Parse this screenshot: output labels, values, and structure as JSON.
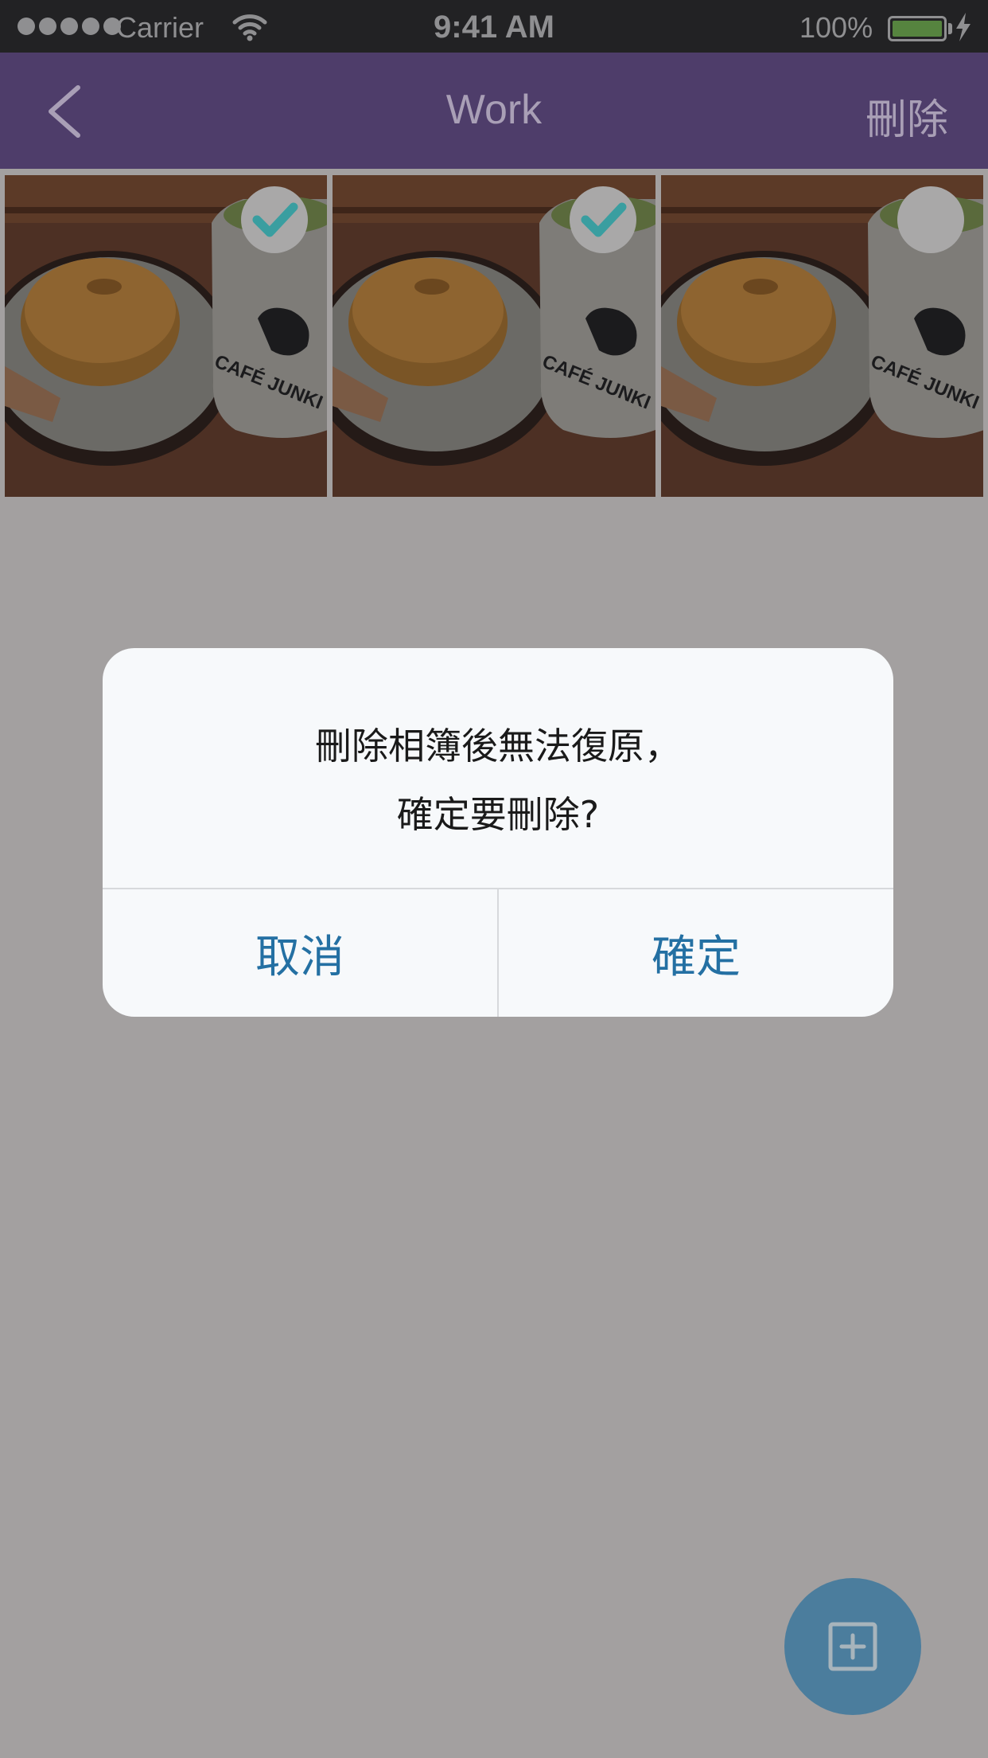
{
  "status_bar": {
    "carrier": "Carrier",
    "time": "9:41 AM",
    "battery": "100%",
    "signal_icon": "signal-dots-icon",
    "wifi_icon": "wifi-icon",
    "battery_icon": "battery-icon",
    "charging_icon": "bolt-icon"
  },
  "nav": {
    "back_icon": "chevron-left-icon",
    "title": "Work",
    "delete_label": "刪除"
  },
  "photos": [
    {
      "cup_text": "CAFÉ JUNKI",
      "selected": true
    },
    {
      "cup_text": "CAFÉ JUNKI",
      "selected": true
    },
    {
      "cup_text": "CAFÉ JUNKI",
      "selected": false
    }
  ],
  "dialog": {
    "line1": "刪除相簿後無法復原，",
    "line2": "確定要刪除?",
    "cancel_label": "取消",
    "confirm_label": "確定"
  },
  "fab": {
    "icon": "add-square-icon"
  },
  "colors": {
    "nav_bg": "#4e3d6a",
    "overlay_bg": "#a3a0a0",
    "check_teal": "#3a9ea0",
    "button_blue": "#2470a3",
    "fab_bg": "#4b7d9d"
  }
}
